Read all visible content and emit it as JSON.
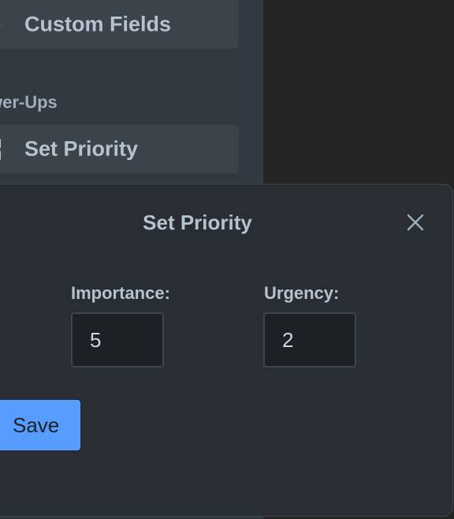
{
  "sidebar": {
    "custom_fields_label": "Custom Fields",
    "custom_fields_icon": "custom-fields-icon",
    "section_heading": "wer-Ups",
    "set_priority_label": "Set Priority",
    "set_priority_icon": "power-up-grid-icon"
  },
  "popover": {
    "title": "Set Priority",
    "close_icon": "close-icon",
    "importance": {
      "label": "Importance:",
      "value": "5"
    },
    "urgency": {
      "label": "Urgency:",
      "value": "2"
    },
    "save_label": "Save"
  },
  "colors": {
    "background": "#252525",
    "sidebar": "#323940",
    "sidebar_button": "#3b434b",
    "popover": "#282e33",
    "input_bg": "#1d2125",
    "text": "#b6c2cf",
    "accent": "#579dff"
  }
}
